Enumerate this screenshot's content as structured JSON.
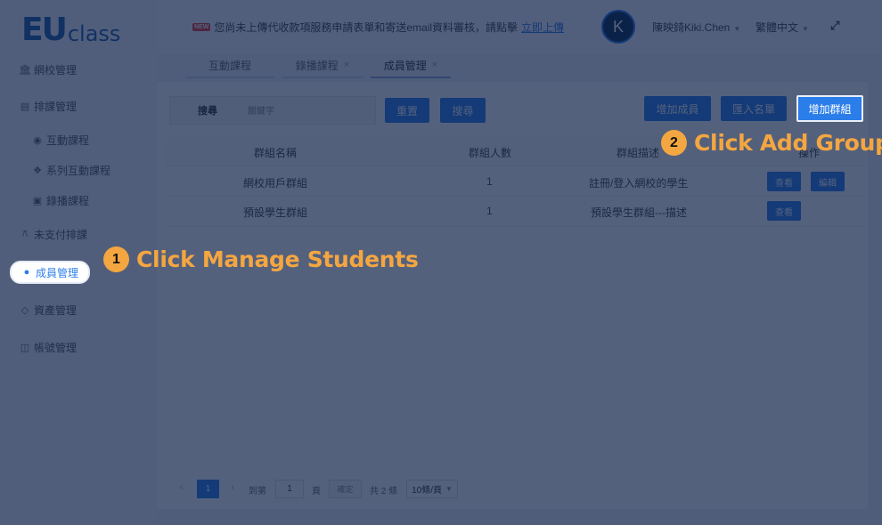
{
  "logo": {
    "part1": "EU",
    "part2": "class"
  },
  "sidebar": {
    "items": [
      {
        "label": "網校管理",
        "icon": "bank-icon"
      },
      {
        "label": "排課管理",
        "icon": "document-icon"
      },
      {
        "label": "互動課程",
        "icon": "eye-icon"
      },
      {
        "label": "系列互動課程",
        "icon": "cubes-icon"
      },
      {
        "label": "錄播課程",
        "icon": "film-icon"
      },
      {
        "label": "未支付排課",
        "icon": "coins-icon"
      },
      {
        "label": "成員管理",
        "icon": "user-icon"
      },
      {
        "label": "資產管理",
        "icon": "diamond-icon"
      },
      {
        "label": "帳號管理",
        "icon": "bag-icon"
      }
    ]
  },
  "header": {
    "new_badge": "NEW",
    "notice": "您尚未上傳代收款項服務申請表單和寄送email資料審核，請點擊",
    "notice_link": "立即上傳",
    "avatar_letter": "K",
    "username": "陳映錡Kiki.Chen",
    "language": "繁體中文",
    "tabs": [
      {
        "label": "互動課程"
      },
      {
        "label": "錄播課程"
      },
      {
        "label": "成員管理"
      }
    ]
  },
  "toolbar": {
    "search_label": "搜尋",
    "search_placeholder": "關鍵字",
    "reset_label": "重置",
    "search_button": "搜尋",
    "add_member": "增加成員",
    "import_list": "匯入名單",
    "add_group": "增加群組"
  },
  "table": {
    "headers": [
      "群組名稱",
      "群組人數",
      "群組描述",
      "操作"
    ],
    "rows": [
      {
        "name": "網校用戶群組",
        "count": "1",
        "desc": "註冊/登入網校的學生",
        "view": "查看",
        "edit": "編輯"
      },
      {
        "name": "預設學生群組",
        "count": "1",
        "desc": "預設學生群組---描述",
        "view": "查看"
      }
    ]
  },
  "pagination": {
    "prev": "‹",
    "current": "1",
    "next": "›",
    "goto_label": "到第",
    "page_input": "1",
    "page_unit": "頁",
    "confirm": "確定",
    "total": "共 2 條",
    "per_page": "10條/頁"
  },
  "callouts": [
    {
      "number": "1",
      "text": "Click Manage Students"
    },
    {
      "number": "2",
      "text": "Click Add Group"
    }
  ],
  "colors": {
    "accent": "#2b7de9",
    "callout": "#f4a640",
    "overlay": "#0b1e46"
  }
}
